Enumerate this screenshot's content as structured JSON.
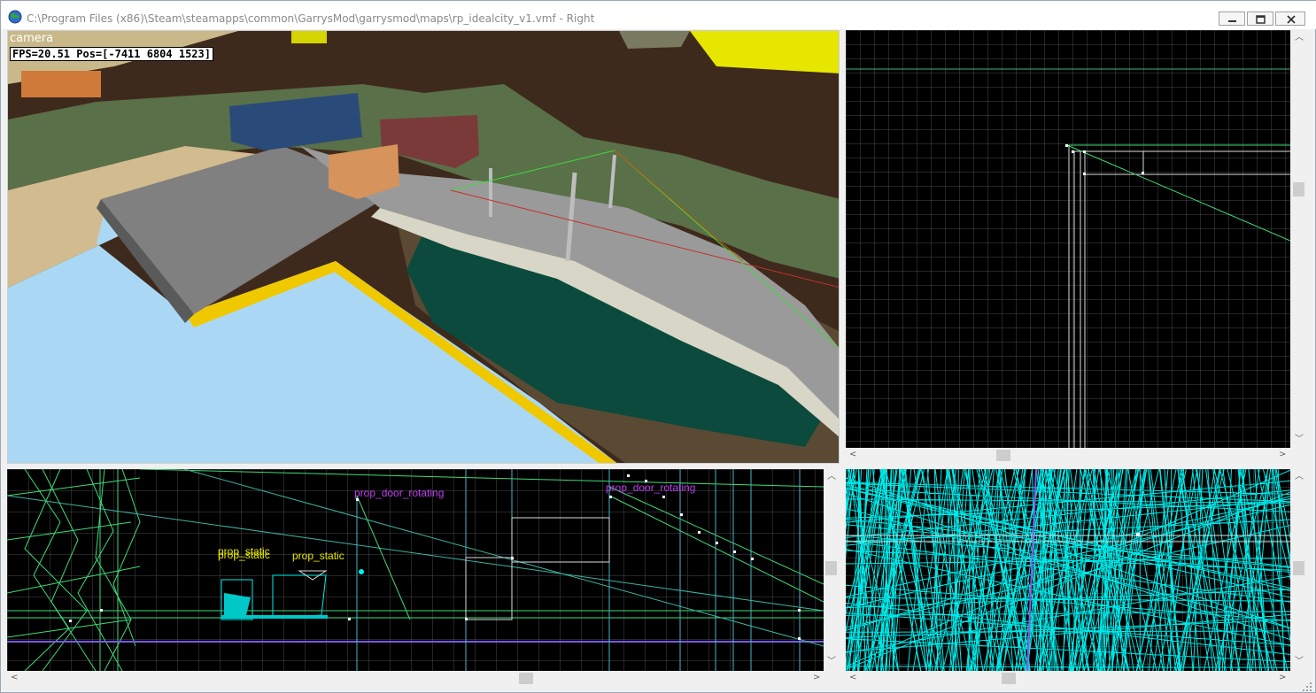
{
  "window": {
    "title": "C:\\Program Files (x86)\\Steam\\steamapps\\common\\GarrysMod\\garrysmod\\maps\\rp_idealcity_v1.vmf - Right",
    "icon": "globe-icon",
    "buttons": [
      "minimize-icon",
      "maximize-icon",
      "close-icon"
    ]
  },
  "viewport_3d": {
    "camera_label": "camera",
    "status": "FPS=20.51 Pos=[-7411 6804 1523]"
  },
  "viewport_front": {
    "labels": [
      {
        "text": "prop_door_rotating",
        "color": "#c03cf0"
      },
      {
        "text": "prop_door_rotating",
        "color": "#c03cf0"
      },
      {
        "text": "prop_static",
        "color": "#e8e800"
      },
      {
        "text": "prop_static",
        "color": "#e8e800"
      },
      {
        "text": "prop_static",
        "color": "#e8e800"
      }
    ]
  },
  "colors": {
    "grid": "#4a4a4a",
    "wire_green": "#3cdc78",
    "wire_cyan": "#00f0f0",
    "entity_magenta": "#c03cf0",
    "entity_yellow": "#e8e800",
    "sky_yellow": "#e6e600",
    "water": "#aad8f4",
    "sea_green": "#0b4a3c"
  }
}
